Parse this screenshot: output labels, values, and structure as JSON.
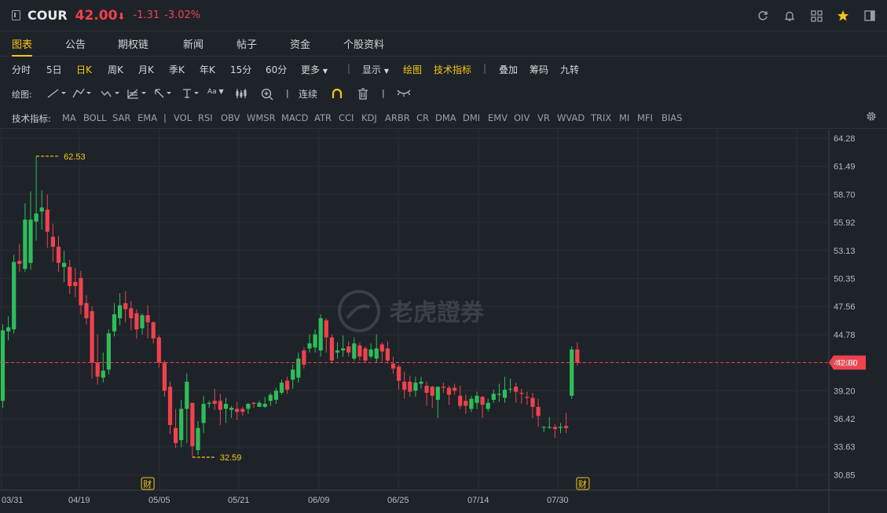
{
  "header": {
    "symbol": "COUR",
    "price": "42.00",
    "arrow": "⬇",
    "change": "-1.31",
    "change_pct": "-3.02%",
    "icons": [
      "refresh-icon",
      "bell-icon",
      "grid-icon",
      "star-icon",
      "sidebar-toggle-icon"
    ]
  },
  "tabs": [
    "图表",
    "公告",
    "期权链",
    "新闻",
    "帖子",
    "资金",
    "个股资料"
  ],
  "periods": {
    "items": [
      "分时",
      "5日",
      "日K",
      "周K",
      "月K",
      "季K",
      "年K",
      "15分",
      "60分",
      "更多"
    ],
    "active": "日K",
    "display": "显示",
    "drawing": "绘图",
    "indicators": "技术指标",
    "overlay": "叠加",
    "chips": "筹码",
    "nine": "九转"
  },
  "drawbar": {
    "label": "绘图:",
    "continuous": "连续",
    "font_icon_text": "Aa"
  },
  "indicators": {
    "label": "技术指标:",
    "main": [
      "MA",
      "BOLL",
      "SAR",
      "EMA"
    ],
    "sub": [
      "VOL",
      "RSI",
      "OBV",
      "WMSR",
      "MACD",
      "ATR",
      "CCI",
      "KDJ",
      "ARBR",
      "CR",
      "DMA",
      "DMI",
      "EMV",
      "OIV",
      "VR",
      "WVAD",
      "TRIX",
      "MI",
      "MFI",
      "BIAS"
    ]
  },
  "watermark": "老虎證券",
  "colors": {
    "up": "#2fbd5a",
    "down": "#f0424d",
    "accent": "#f5c518",
    "background": "#1e2329"
  },
  "chart_data": {
    "type": "candlestick",
    "y_ticks": [
      "64.28",
      "61.49",
      "58.70",
      "55.92",
      "53.13",
      "50.35",
      "47.56",
      "44.78",
      "42.00",
      "39.20",
      "36.42",
      "33.63",
      "30.85"
    ],
    "ylim": [
      29.5,
      65.5
    ],
    "x_labels": [
      "03/31",
      "04/19",
      "05/05",
      "05/21",
      "06/09",
      "06/25",
      "07/14",
      "07/30"
    ],
    "last_price": "42.00",
    "high_label": "62.53",
    "low_label": "32.59",
    "earnings_marker": "财",
    "earnings_at": [
      26,
      104
    ],
    "candles": [
      [
        38.2,
        45.2,
        37.5,
        45.8
      ],
      [
        45.1,
        45.5,
        44.2,
        46.6
      ],
      [
        45.3,
        52.0,
        44.9,
        52.7
      ],
      [
        52.1,
        51.8,
        51.0,
        53.8
      ],
      [
        51.3,
        56.2,
        51.0,
        57.8
      ],
      [
        51.9,
        56.2,
        51.2,
        59.0
      ],
      [
        56.0,
        56.8,
        54.1,
        62.5
      ],
      [
        57.0,
        57.4,
        55.2,
        59.1
      ],
      [
        57.2,
        55.0,
        53.4,
        58.7
      ],
      [
        54.5,
        53.5,
        52.0,
        55.8
      ],
      [
        53.5,
        51.9,
        51.0,
        54.6
      ],
      [
        51.5,
        51.9,
        50.0,
        53.1
      ],
      [
        51.5,
        49.6,
        48.8,
        52.2
      ],
      [
        50.0,
        49.6,
        48.5,
        51.4
      ],
      [
        50.4,
        47.7,
        46.8,
        51.1
      ],
      [
        47.9,
        46.4,
        45.8,
        48.7
      ],
      [
        47.1,
        42.0,
        40.4,
        47.6
      ],
      [
        42.0,
        40.6,
        39.8,
        44.8
      ],
      [
        40.5,
        41.2,
        40.0,
        43.0
      ],
      [
        41.3,
        44.9,
        40.8,
        45.3
      ],
      [
        45.1,
        46.8,
        44.6,
        47.9
      ],
      [
        46.4,
        47.7,
        45.7,
        48.9
      ],
      [
        47.9,
        47.3,
        46.0,
        49.1
      ],
      [
        47.4,
        46.4,
        45.2,
        48.1
      ],
      [
        46.9,
        45.3,
        44.4,
        47.3
      ],
      [
        45.4,
        46.7,
        44.8,
        46.9
      ],
      [
        46.7,
        46.0,
        44.4,
        47.7
      ],
      [
        46.0,
        44.4,
        43.9,
        46.1
      ],
      [
        44.5,
        42.0,
        41.5,
        44.7
      ],
      [
        42.0,
        39.2,
        38.6,
        42.2
      ],
      [
        39.6,
        35.8,
        34.9,
        40.1
      ],
      [
        35.5,
        34.0,
        33.5,
        37.4
      ],
      [
        34.3,
        37.4,
        33.6,
        38.3
      ],
      [
        37.4,
        40.1,
        34.0,
        40.9
      ],
      [
        38.0,
        33.7,
        32.6,
        38.0
      ],
      [
        33.3,
        35.5,
        32.8,
        36.2
      ],
      [
        36.0,
        37.9,
        35.0,
        38.7
      ],
      [
        37.9,
        38.0,
        37.5,
        38.2
      ],
      [
        38.2,
        37.9,
        37.3,
        39.4
      ],
      [
        38.2,
        37.3,
        35.8,
        38.9
      ],
      [
        37.4,
        37.9,
        36.0,
        38.5
      ],
      [
        37.3,
        37.5,
        36.5,
        37.7
      ],
      [
        37.4,
        37.1,
        36.3,
        38.1
      ],
      [
        37.4,
        37.1,
        36.7,
        37.6
      ],
      [
        37.4,
        37.9,
        36.9,
        38.0
      ],
      [
        38.0,
        37.9,
        37.5,
        38.1
      ],
      [
        37.6,
        38.0,
        37.7,
        38.2
      ],
      [
        37.6,
        37.9,
        37.5,
        38.6
      ],
      [
        38.2,
        38.8,
        37.7,
        39.0
      ],
      [
        38.3,
        39.2,
        37.9,
        39.5
      ],
      [
        39.0,
        40.0,
        38.8,
        40.3
      ],
      [
        40.2,
        39.3,
        38.9,
        40.6
      ],
      [
        40.3,
        41.3,
        39.4,
        41.8
      ],
      [
        40.5,
        42.4,
        40.0,
        43.0
      ],
      [
        43.2,
        41.8,
        41.4,
        43.5
      ],
      [
        43.4,
        43.9,
        43.0,
        44.8
      ],
      [
        43.5,
        44.8,
        43.0,
        45.3
      ],
      [
        43.2,
        46.4,
        42.6,
        46.8
      ],
      [
        46.2,
        44.5,
        43.0,
        46.4
      ],
      [
        44.5,
        42.2,
        41.9,
        44.8
      ],
      [
        43.0,
        43.2,
        42.4,
        44.0
      ],
      [
        43.2,
        43.4,
        42.6,
        44.7
      ],
      [
        43.6,
        43.0,
        42.6,
        44.1
      ],
      [
        42.4,
        43.9,
        42.2,
        44.5
      ],
      [
        43.7,
        42.6,
        42.2,
        44.0
      ],
      [
        43.4,
        42.2,
        42.0,
        43.6
      ],
      [
        42.6,
        43.3,
        42.4,
        43.9
      ],
      [
        42.4,
        43.4,
        42.0,
        44.8
      ],
      [
        43.8,
        43.1,
        42.1,
        44.0
      ],
      [
        43.4,
        42.2,
        41.9,
        44.1
      ],
      [
        41.9,
        41.4,
        40.9,
        42.6
      ],
      [
        41.6,
        40.2,
        39.3,
        41.8
      ],
      [
        40.1,
        39.3,
        38.4,
        41.1
      ],
      [
        40.1,
        39.1,
        38.6,
        40.7
      ],
      [
        39.2,
        40.0,
        38.6,
        40.6
      ],
      [
        39.9,
        40.1,
        39.4,
        40.6
      ],
      [
        39.7,
        39.0,
        37.7,
        40.1
      ],
      [
        39.6,
        38.7,
        37.5,
        39.7
      ],
      [
        38.3,
        39.6,
        36.5,
        39.6
      ],
      [
        39.6,
        39.5,
        39.0,
        40.0
      ],
      [
        39.5,
        38.8,
        37.8,
        39.7
      ],
      [
        39.5,
        39.2,
        38.8,
        39.9
      ],
      [
        38.7,
        37.7,
        37.4,
        39.7
      ],
      [
        38.2,
        37.7,
        36.9,
        38.8
      ],
      [
        37.4,
        38.4,
        37.1,
        38.7
      ],
      [
        38.0,
        38.7,
        37.4,
        39.1
      ],
      [
        38.6,
        37.8,
        36.5,
        38.7
      ],
      [
        37.4,
        38.0,
        37.1,
        38.4
      ],
      [
        38.3,
        38.9,
        38.0,
        39.3
      ],
      [
        38.8,
        38.9,
        38.1,
        39.9
      ],
      [
        38.5,
        39.3,
        38.0,
        40.6
      ],
      [
        39.4,
        39.4,
        39.0,
        40.4
      ],
      [
        39.6,
        39.1,
        38.0,
        40.0
      ],
      [
        39.0,
        38.9,
        37.9,
        39.4
      ],
      [
        38.6,
        38.5,
        37.8,
        39.1
      ],
      [
        38.5,
        37.6,
        36.5,
        39.0
      ],
      [
        37.6,
        36.7,
        35.6,
        38.4
      ],
      [
        35.6,
        35.6,
        35.1,
        35.7
      ],
      [
        35.6,
        35.6,
        35.4,
        36.6
      ],
      [
        35.6,
        35.4,
        34.5,
        35.9
      ],
      [
        35.5,
        35.6,
        35.0,
        36.0
      ],
      [
        35.7,
        35.5,
        35.0,
        37.0
      ],
      [
        38.7,
        43.3,
        38.4,
        43.6
      ],
      [
        43.3,
        42.0,
        41.7,
        44.0
      ]
    ]
  }
}
